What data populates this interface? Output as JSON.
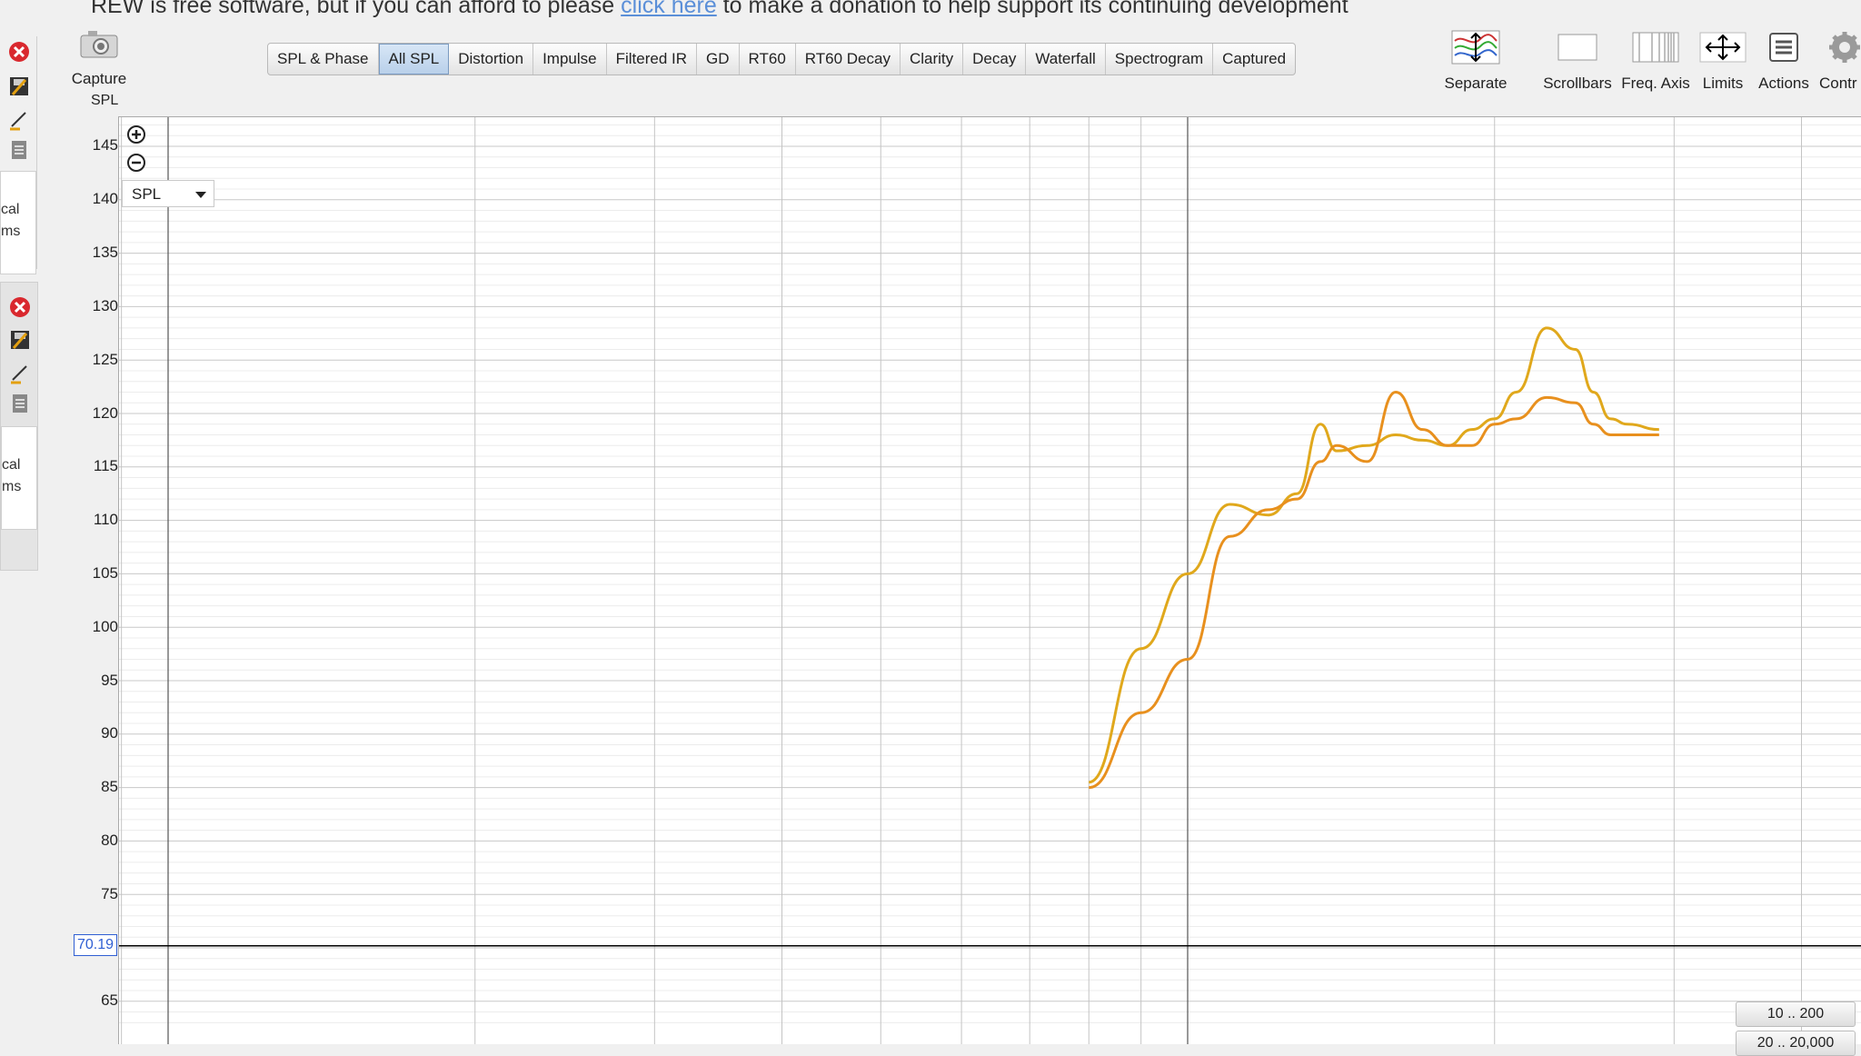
{
  "banner": {
    "text_before": "REW is free software, but if you can afford to please ",
    "link_text": "click here",
    "text_after": " to make a donation to help support its continuing development"
  },
  "left_strip": {
    "panel1_lines": [
      "cal",
      "ms"
    ],
    "panel2_lines": [
      "cal",
      "ms"
    ],
    "icons": [
      "remove-icon",
      "save-icon",
      "pen-icon",
      "notes-icon"
    ]
  },
  "capture": {
    "label": "Capture",
    "icon": "camera-icon"
  },
  "tabs": [
    {
      "label": "SPL & Phase",
      "active": false
    },
    {
      "label": "All SPL",
      "active": true
    },
    {
      "label": "Distortion",
      "active": false
    },
    {
      "label": "Impulse",
      "active": false
    },
    {
      "label": "Filtered IR",
      "active": false
    },
    {
      "label": "GD",
      "active": false
    },
    {
      "label": "RT60",
      "active": false
    },
    {
      "label": "RT60 Decay",
      "active": false
    },
    {
      "label": "Clarity",
      "active": false
    },
    {
      "label": "Decay",
      "active": false
    },
    {
      "label": "Waterfall",
      "active": false
    },
    {
      "label": "Spectrogram",
      "active": false
    },
    {
      "label": "Captured",
      "active": false
    }
  ],
  "toolbar": {
    "separate": "Separate",
    "scrollbars": "Scrollbars",
    "freq_axis": "Freq. Axis",
    "limits": "Limits",
    "actions": "Actions",
    "controls": "Contr"
  },
  "graph": {
    "y_unit_label": "SPL",
    "y_ticks": [
      "145",
      "140",
      "135",
      "130",
      "125",
      "120",
      "115",
      "110",
      "105",
      "100",
      "95",
      "90",
      "85",
      "80",
      "75",
      "65"
    ],
    "cursor_value": "70.19",
    "select_value": "SPL",
    "range_buttons": [
      "10 .. 200",
      "20 .. 20,000"
    ]
  },
  "chart_data": {
    "type": "line",
    "xlabel": "",
    "ylabel": "SPL",
    "xscale": "log",
    "xlim": [
      10,
      300
    ],
    "ylim": [
      63,
      150
    ],
    "cursor_y": 70.19,
    "grid": true,
    "series": [
      {
        "color": "#e0a81c",
        "x": [
          80,
          90,
          100,
          110,
          120,
          128,
          135,
          140,
          150,
          160,
          170,
          180,
          190,
          200,
          210,
          225,
          240,
          250,
          260,
          270,
          290
        ],
        "y": [
          85.5,
          98,
          105,
          111.5,
          110.5,
          112.5,
          119,
          116.5,
          117,
          118,
          117.5,
          117,
          118.5,
          119.5,
          122,
          128,
          126,
          122,
          119.5,
          119,
          118.5
        ]
      },
      {
        "color": "#e8901e",
        "x": [
          80,
          90,
          100,
          110,
          120,
          128,
          135,
          140,
          150,
          160,
          170,
          180,
          190,
          200,
          210,
          225,
          240,
          250,
          260,
          270,
          290
        ],
        "y": [
          85,
          92,
          97,
          108.5,
          111,
          112,
          115.5,
          117,
          115.5,
          122,
          118.5,
          117,
          117,
          119,
          119.5,
          121.5,
          121,
          119,
          118,
          118,
          118
        ]
      }
    ]
  }
}
